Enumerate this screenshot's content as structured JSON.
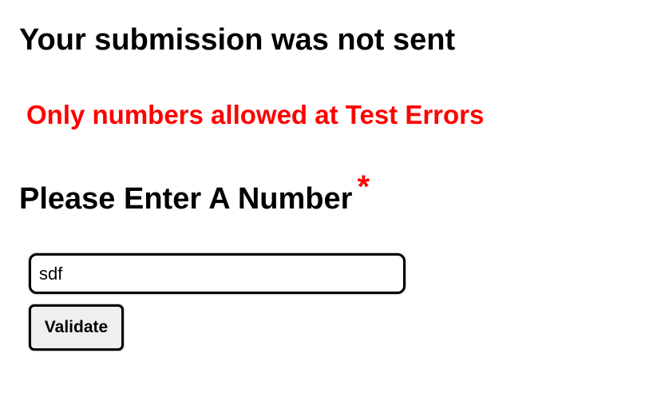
{
  "page": {
    "title": "Your submission was not sent"
  },
  "error": {
    "message": "Only numbers allowed at Test Errors"
  },
  "form": {
    "field_label": "Please Enter A Number",
    "required_marker": "*",
    "input_value": "sdf",
    "submit_label": "Validate"
  },
  "colors": {
    "error": "#ff0000",
    "text": "#000000",
    "button_background": "#efefef"
  }
}
